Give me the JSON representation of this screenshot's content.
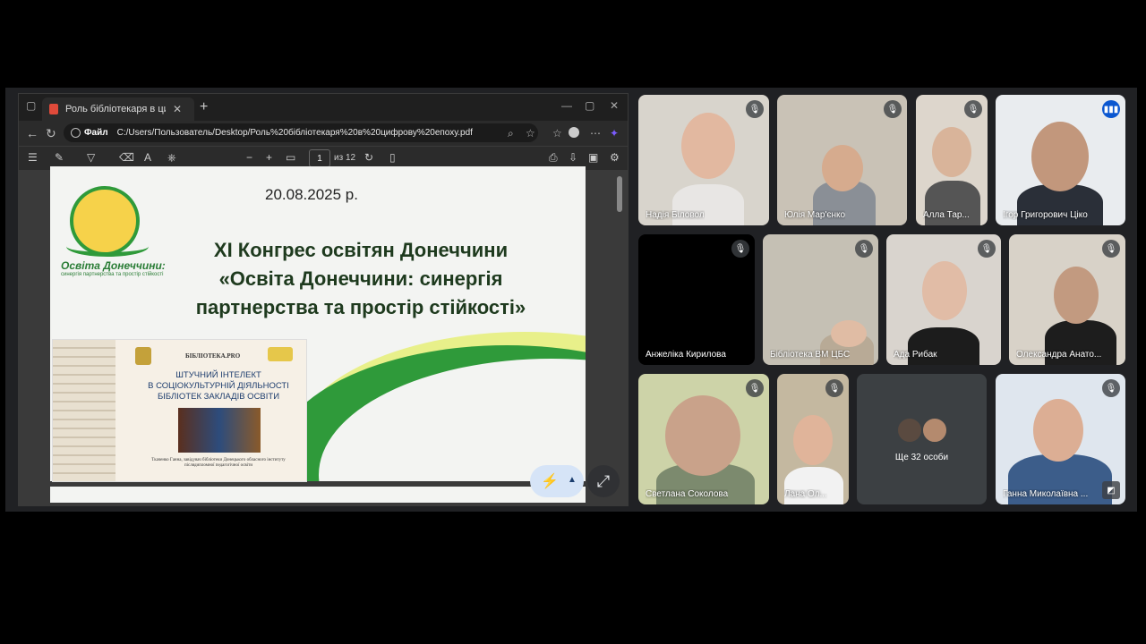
{
  "browser": {
    "tab_title": "Роль бібліотекаря в цифрову е",
    "address_label": "Файл",
    "address_url": "C:/Users/Пользователь/Desktop/Роль%20бібліотекаря%20в%20цифрову%20епоху.pdf",
    "page_number": "1",
    "page_total": "из 12"
  },
  "slide": {
    "date": "20.08.2025 р.",
    "title_line1": "ХІ Конгрес освітян Донеччини",
    "title_line2": "«Освіта Донеччини: синергія",
    "title_line3": "партнерства та простір стійкості»",
    "logo_title": "Освіта Донеччини:",
    "logo_subtitle": "синергія партнерства та простір стійкості"
  },
  "inset": {
    "library_label": "БІБЛІОТЕКА.PRO",
    "title_line1": "ШТУЧНИЙ ІНТЕЛЕКТ",
    "title_line2": "В СОЦІОКУЛЬТУРНІЙ ДІЯЛЬНОСТІ",
    "title_line3": "БІБЛІОТЕК ЗАКЛАДІВ ОСВІТИ",
    "author": "Ткаченко Ганна, завідувач бібліотеки Донецького обласного інституту післядипломної педагогічної освіти"
  },
  "participants": [
    {
      "name": "Надія Біловол"
    },
    {
      "name": "Юлія Мар'єнко"
    },
    {
      "name": "Алла Тар..."
    },
    {
      "name": "Ігор Григорович Ціко"
    },
    {
      "name": "Анжеліка Кирилова"
    },
    {
      "name": "Бібліотека ВМ ЦБС"
    },
    {
      "name": "Ада Рибак"
    },
    {
      "name": "Олександра Анато..."
    },
    {
      "name": "Светлана Соколова"
    },
    {
      "name": "Лана Ол..."
    },
    {
      "name": "Ганна Миколаївна ..."
    }
  ],
  "others": {
    "label": "Ще 32 особи"
  }
}
